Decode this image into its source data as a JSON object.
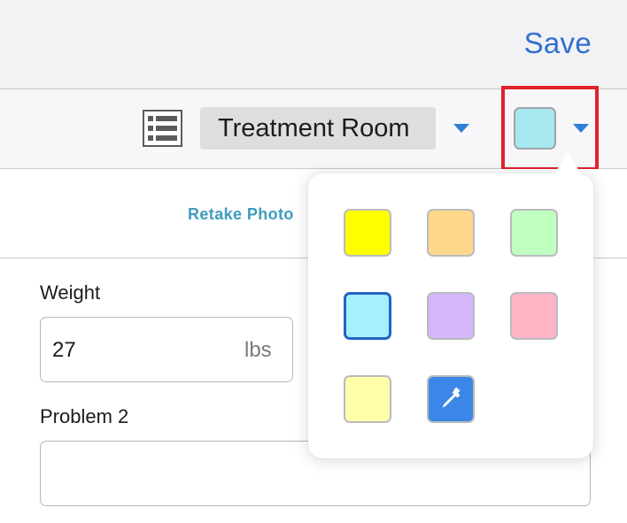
{
  "nav": {
    "save_label": "Save"
  },
  "toolbar": {
    "list_icon": "list-icon",
    "room_selected": "Treatment Room",
    "room_dropdown_icon": "chevron-down-icon",
    "current_color": "#a6e8ef",
    "color_dropdown_icon": "chevron-down-icon",
    "highlight_color": "#e0222c"
  },
  "photo": {
    "retake_label": "Retake Photo"
  },
  "form": {
    "weight": {
      "label": "Weight",
      "value": "27",
      "unit": "lbs"
    },
    "problem2": {
      "label": "Problem 2",
      "value": ""
    }
  },
  "color_picker": {
    "swatches": [
      {
        "name": "yellow",
        "color": "#ffff00"
      },
      {
        "name": "orange",
        "color": "#ffd78a"
      },
      {
        "name": "green",
        "color": "#bfffbf"
      },
      {
        "name": "cyan",
        "color": "#a6f0fb",
        "selected": true
      },
      {
        "name": "purple",
        "color": "#d5b6fb"
      },
      {
        "name": "pink",
        "color": "#ffb4c5"
      },
      {
        "name": "light-yellow",
        "color": "#ffffaa"
      }
    ],
    "eyedropper_icon": "eyedropper-icon",
    "eyedropper_color": "#3b86e6",
    "selected_border_color": "#2463c6"
  }
}
